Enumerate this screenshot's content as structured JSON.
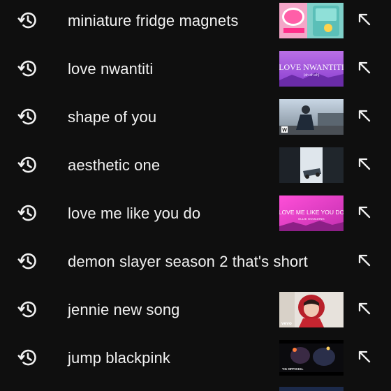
{
  "suggestions": [
    {
      "text": "miniature fridge magnets",
      "thumb_icon": "fridge-magnets-thumbnail",
      "fill_icon": "arrow-up-left-icon"
    },
    {
      "text": "love nwantiti",
      "thumb_icon": "love-nwantiti-thumbnail",
      "thumb_title": "LOVE NWANTITI",
      "thumb_sub": "(ah ah ah)",
      "fill_icon": "arrow-up-left-icon"
    },
    {
      "text": "shape of you",
      "thumb_icon": "shape-of-you-thumbnail",
      "thumb_badge": "W",
      "fill_icon": "arrow-up-left-icon"
    },
    {
      "text": "aesthetic one",
      "thumb_icon": "aesthetic-one-thumbnail",
      "fill_icon": "arrow-up-left-icon"
    },
    {
      "text": "love me like you do",
      "thumb_icon": "love-me-like-you-do-thumbnail",
      "thumb_title": "LOVE ME LIKE YOU DO",
      "thumb_sub": "ELLIE GOULDING",
      "fill_icon": "arrow-up-left-icon"
    },
    {
      "text": "demon slayer season 2 that's short",
      "fill_icon": "arrow-up-left-icon"
    },
    {
      "text": "jennie new song",
      "thumb_icon": "jennie-new-song-thumbnail",
      "thumb_badge": "vevo",
      "fill_icon": "arrow-up-left-icon"
    },
    {
      "text": "jump blackpink",
      "thumb_icon": "jump-blackpink-thumbnail",
      "thumb_badge": "YG OFFICIAL",
      "fill_icon": "arrow-up-left-icon"
    }
  ],
  "colors": {
    "background": "#0f0f0f",
    "text": "#f1f1f1",
    "icon": "#f1f1f1"
  }
}
